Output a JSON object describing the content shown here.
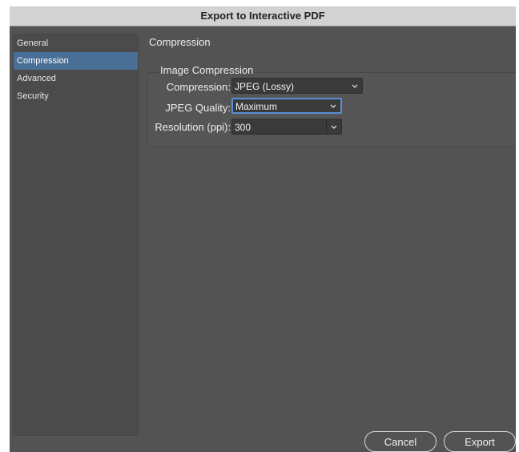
{
  "window": {
    "title": "Export to Interactive PDF"
  },
  "sidebar": {
    "items": [
      {
        "label": "General"
      },
      {
        "label": "Compression"
      },
      {
        "label": "Advanced"
      },
      {
        "label": "Security"
      }
    ],
    "selected": "Compression"
  },
  "main": {
    "section_title": "Compression",
    "group_title": "Image Compression",
    "compression": {
      "label": "Compression:",
      "value": "JPEG (Lossy)"
    },
    "jpeg_quality": {
      "label": "JPEG Quality:",
      "value": "Maximum"
    },
    "resolution": {
      "label": "Resolution (ppi):",
      "value": "300"
    }
  },
  "footer": {
    "cancel_label": "Cancel",
    "export_label": "Export"
  },
  "colors": {
    "dialog_bg": "#535353",
    "titlebar_bg": "#d2d2d2",
    "selected_item_bg": "#4a6f97",
    "focus_ring": "#5b8ed8"
  },
  "icons": [
    "chevron-down-icon"
  ]
}
